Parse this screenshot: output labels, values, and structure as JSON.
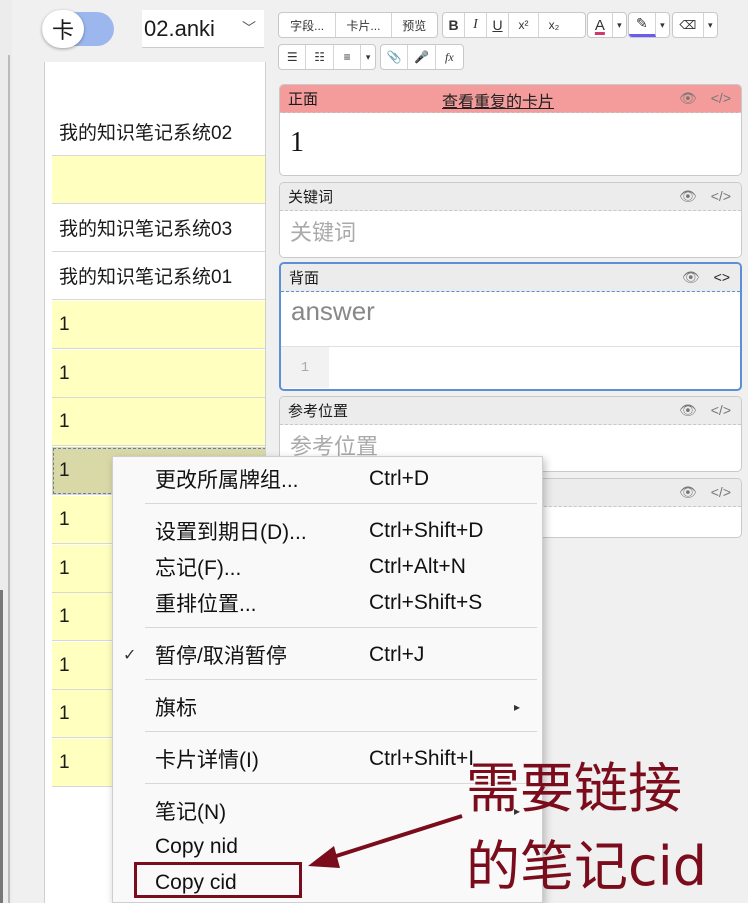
{
  "toolbar_left": {
    "toggle_label": "卡",
    "deck_name": "02.anki"
  },
  "card_list": {
    "rows": [
      {
        "text": "",
        "style": "white"
      },
      {
        "text": "我的知识笔记系统02",
        "style": "white"
      },
      {
        "text": "",
        "style": "yellow"
      },
      {
        "text": "我的知识笔记系统03",
        "style": "white"
      },
      {
        "text": "我的知识笔记系统01",
        "style": "white"
      },
      {
        "text": "1",
        "style": "yellow"
      },
      {
        "text": "1",
        "style": "yellow"
      },
      {
        "text": "1",
        "style": "yellow"
      },
      {
        "text": "1",
        "style": "selected"
      },
      {
        "text": "1",
        "style": "yellow"
      },
      {
        "text": "1",
        "style": "yellow"
      },
      {
        "text": "1",
        "style": "yellow"
      },
      {
        "text": "1",
        "style": "yellow"
      },
      {
        "text": "1",
        "style": "yellow"
      },
      {
        "text": "1",
        "style": "yellow"
      }
    ]
  },
  "editor_toolbar": {
    "fields_btn": "字段...",
    "cards_btn": "卡片...",
    "preview_btn": "预览",
    "bold": "B",
    "italic": "I",
    "underline": "U",
    "superscript": "x²",
    "subscript": "x₂",
    "text_color": "A",
    "highlight": "✎",
    "eraser": "⌫",
    "bullets": "☰",
    "numbered": "☷",
    "align": "≡",
    "attach": "📎",
    "record": "🎤",
    "formula": "fx"
  },
  "fields": {
    "front": {
      "label": "正面",
      "dup_link": "查看重复的卡片",
      "value": "1"
    },
    "keywords": {
      "label": "关键词",
      "placeholder": "关键词"
    },
    "back": {
      "label": "背面",
      "placeholder": "answer",
      "line_number": "1"
    },
    "reference": {
      "label": "参考位置",
      "placeholder": "参考位置"
    }
  },
  "context_menu": {
    "items": [
      {
        "label": "更改所属牌组...",
        "shortcut": "Ctrl+D"
      },
      {
        "label": "设置到期日(D)...",
        "shortcut": "Ctrl+Shift+D"
      },
      {
        "label": "忘记(F)...",
        "shortcut": "Ctrl+Alt+N"
      },
      {
        "label": "重排位置...",
        "shortcut": "Ctrl+Shift+S"
      },
      {
        "label": "暂停/取消暂停",
        "shortcut": "Ctrl+J",
        "check": "✓"
      },
      {
        "label": "旗标",
        "shortcut": "",
        "arrow": "▸"
      },
      {
        "label": "卡片详情(I)",
        "shortcut": "Ctrl+Shift+I"
      },
      {
        "label": "笔记(N)",
        "shortcut": "",
        "arrow": "▸"
      },
      {
        "label": "Copy nid",
        "shortcut": ""
      },
      {
        "label": "Copy cid",
        "shortcut": ""
      }
    ]
  },
  "annotation": {
    "line1": "需要链接",
    "line2": "的笔记cid",
    "color": "#7a0c1c"
  }
}
